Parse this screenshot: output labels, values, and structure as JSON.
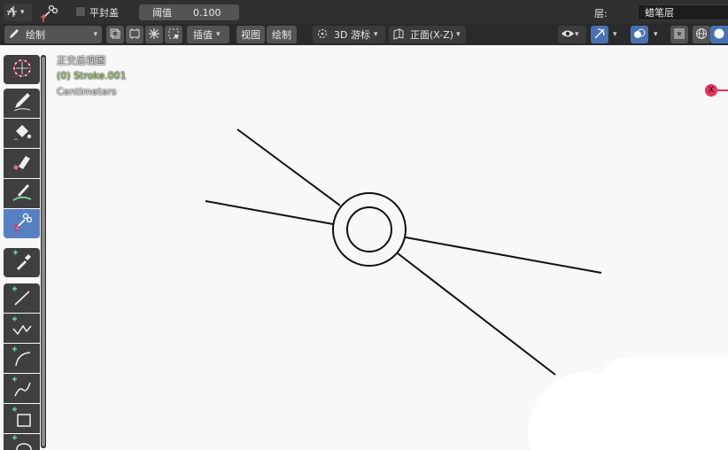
{
  "header": {
    "proportional_icon": "proportional-edit-icon",
    "snap_icon": "snap-icon",
    "flat_cap_label": "平封盖",
    "threshold_label": "阈值",
    "threshold_value": "0.100",
    "layer_label": "层:",
    "layer_value": "蜡笔层"
  },
  "toolbar": {
    "mode_label": "绘制",
    "interp_label": "插值",
    "view_menu": "视图",
    "draw_menu": "绘制",
    "cursor_label": "3D 游标",
    "plane_label": "正面(X-Z)"
  },
  "viewport": {
    "view_name": "正交后视图",
    "object_name": "(0) Stroke.001",
    "units": "Centimeters",
    "gizmo_axis_label": "X"
  },
  "tools": [
    {
      "name": "cursor-tool",
      "icon": "cursor-icon"
    },
    {
      "name": "draw-tool",
      "icon": "pencil-icon"
    },
    {
      "name": "fill-tool",
      "icon": "bucket-fill-icon"
    },
    {
      "name": "erase-tool",
      "icon": "eraser-icon"
    },
    {
      "name": "tint-tool",
      "icon": "brush-tint-icon"
    },
    {
      "name": "cutter-tool",
      "icon": "cutter-icon"
    },
    {
      "name": "eyedropper-tool",
      "icon": "eyedropper-icon"
    },
    {
      "name": "line-tool",
      "icon": "line-icon"
    },
    {
      "name": "polyline-tool",
      "icon": "polyline-icon"
    },
    {
      "name": "arc-tool",
      "icon": "arc-icon"
    },
    {
      "name": "curve-tool",
      "icon": "curve-icon"
    },
    {
      "name": "box-tool",
      "icon": "box-icon"
    },
    {
      "name": "circle-tool",
      "icon": "circle-icon"
    }
  ],
  "colors": {
    "active_tool": "#5680c2",
    "overlay_green": "#9fd36f",
    "axis_x_red": "#e8325a"
  }
}
